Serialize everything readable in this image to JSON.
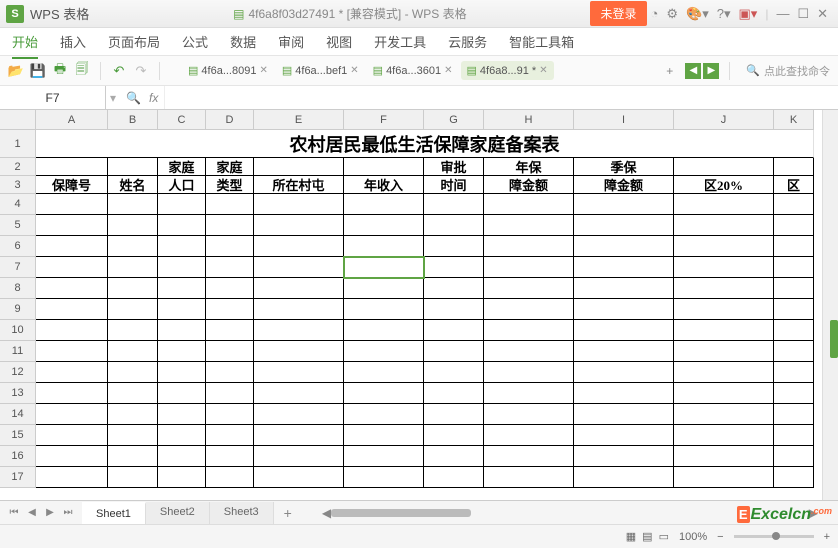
{
  "titlebar": {
    "app_name": "WPS 表格",
    "doc_title": "4f6a8f03d27491 * [兼容模式] - WPS 表格",
    "login_label": "未登录"
  },
  "menubar": {
    "items": [
      "开始",
      "插入",
      "页面布局",
      "公式",
      "数据",
      "审阅",
      "视图",
      "开发工具",
      "云服务",
      "智能工具箱"
    ],
    "active_index": 0
  },
  "doc_tabs": {
    "items": [
      {
        "label": "4f6a...8091"
      },
      {
        "label": "4f6a...bef1"
      },
      {
        "label": "4f6a...3601"
      },
      {
        "label": "4f6a8...91 *"
      }
    ],
    "active_index": 3
  },
  "search_placeholder": "点此查找命令",
  "formula_bar": {
    "cell_ref": "F7",
    "fx_label": "fx",
    "formula": ""
  },
  "columns": [
    {
      "letter": "A",
      "width": 72
    },
    {
      "letter": "B",
      "width": 50
    },
    {
      "letter": "C",
      "width": 48
    },
    {
      "letter": "D",
      "width": 48
    },
    {
      "letter": "E",
      "width": 90
    },
    {
      "letter": "F",
      "width": 80
    },
    {
      "letter": "G",
      "width": 60
    },
    {
      "letter": "H",
      "width": 90
    },
    {
      "letter": "I",
      "width": 100
    },
    {
      "letter": "J",
      "width": 100
    },
    {
      "letter": "K",
      "width": 40
    }
  ],
  "chart_data": {
    "type": "table",
    "title": "农村居民最低生活保障家庭备案表",
    "headers": [
      "保障号",
      "姓名",
      "家庭人口",
      "家庭类型",
      "所在村屯",
      "年收入",
      "审批时间",
      "年保障金额",
      "季保障金额",
      "区20%",
      "区"
    ],
    "rows": []
  },
  "row_heights": {
    "r1": 28,
    "r2": 18,
    "r3": 18,
    "default": 21
  },
  "visible_rows": 17,
  "selected_cell": {
    "row": 7,
    "col": "F"
  },
  "sheets": {
    "items": [
      "Sheet1",
      "Sheet2",
      "Sheet3"
    ],
    "active_index": 0
  },
  "status": {
    "zoom": "100%",
    "zoom_minus": "−",
    "zoom_plus": "+"
  },
  "watermark": {
    "text": "Excelcn",
    "suffix": ".com"
  }
}
